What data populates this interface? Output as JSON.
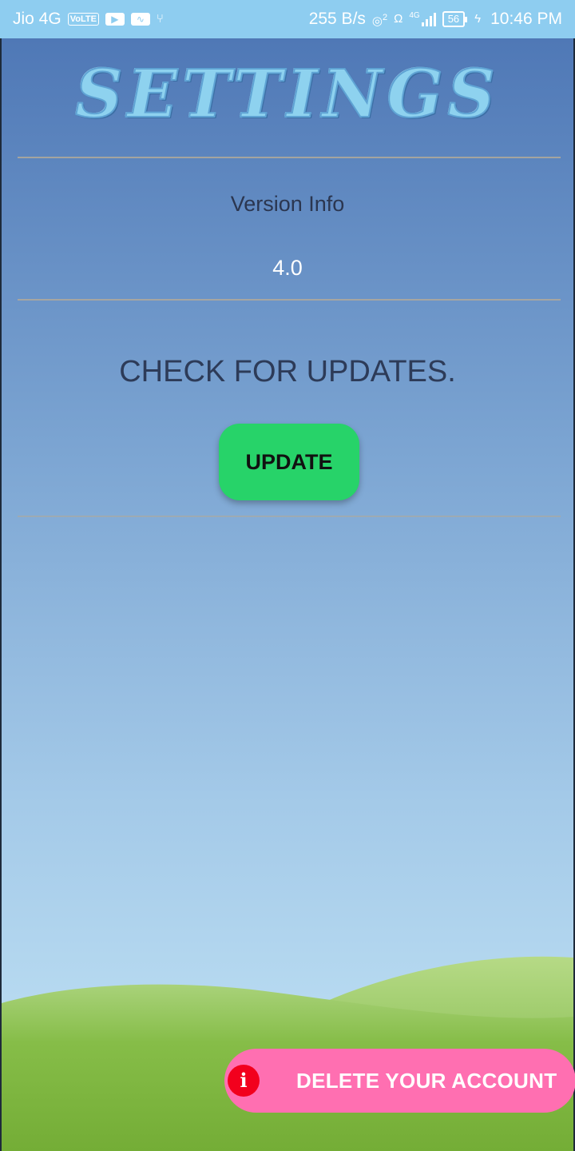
{
  "status_bar": {
    "carrier": "Jio 4G",
    "volte_badge": "VoLTE",
    "data_speed": "255 B/s",
    "hotspot_count": "2",
    "network_type": "4G",
    "battery_level": "56",
    "time": "10:46 PM",
    "icons": [
      "volte-icon",
      "youtube-icon",
      "activity-icon",
      "usb-icon",
      "hotspot-icon",
      "headset-icon",
      "signal-icon",
      "battery-icon",
      "charging-icon"
    ]
  },
  "header": {
    "title": "SETTINGS"
  },
  "version": {
    "label": "Version Info",
    "value": "4.0"
  },
  "updates": {
    "heading": "CHECK FOR UPDATES.",
    "button_label": "UPDATE"
  },
  "delete_account": {
    "label": "DELETE YOUR ACCOUNT",
    "icon_glyph": "i"
  },
  "colors": {
    "status_bar": "#8ecdf0",
    "update_button": "#27d369",
    "delete_button": "#ff6fb1",
    "info_icon": "#f2001d",
    "hills": "#7fb83d"
  }
}
